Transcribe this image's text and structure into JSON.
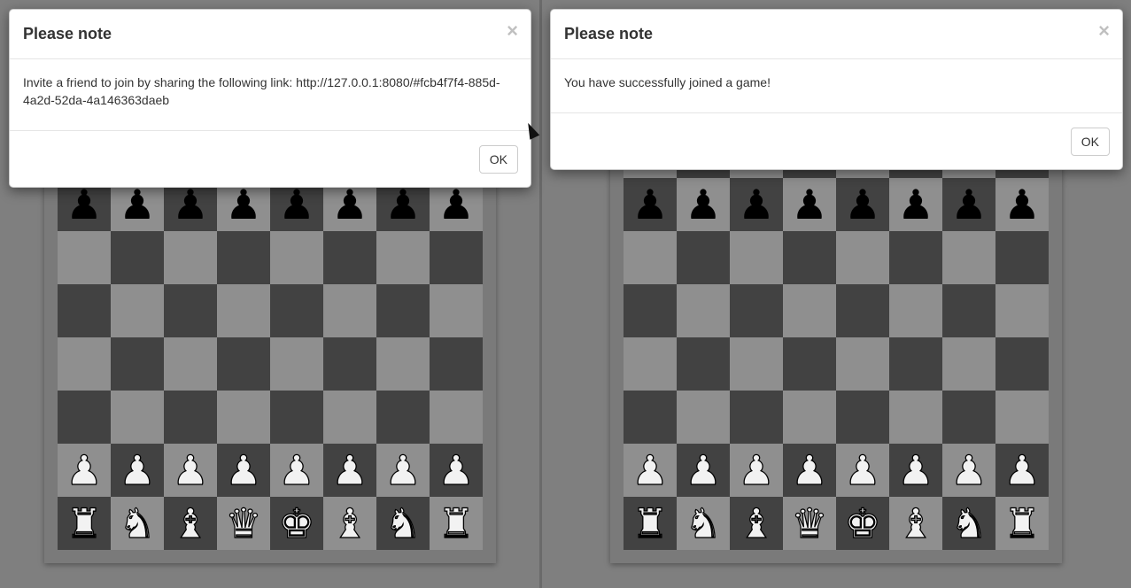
{
  "left_window": {
    "modal": {
      "title": "Please note",
      "close_glyph": "×",
      "body": "Invite a friend to join by sharing the following link: http://127.0.0.1:8080/#fcb4f7f4-885d-4a2d-52da-4a146363daeb",
      "ok_label": "OK"
    },
    "board": {
      "rows": [
        [
          "",
          "",
          "",
          "",
          "",
          "",
          "",
          ""
        ],
        [
          "♟",
          "♟",
          "♟",
          "♟",
          "♟",
          "♟",
          "♟",
          "♟"
        ],
        [
          "",
          "",
          "",
          "",
          "",
          "",
          "",
          ""
        ],
        [
          "",
          "",
          "",
          "",
          "",
          "",
          "",
          ""
        ],
        [
          "",
          "",
          "",
          "",
          "",
          "",
          "",
          ""
        ],
        [
          "",
          "",
          "",
          "",
          "",
          "",
          "",
          ""
        ],
        [
          "♟",
          "♟",
          "♟",
          "♟",
          "♟",
          "♟",
          "♟",
          "♟"
        ],
        [
          "♜",
          "♞",
          "♝",
          "♛",
          "♚",
          "♝",
          "♞",
          "♜"
        ]
      ],
      "colors": [
        [
          "",
          "",
          "",
          "",
          "",
          "",
          "",
          ""
        ],
        [
          "black",
          "black",
          "black",
          "black",
          "black",
          "black",
          "black",
          "black"
        ],
        [
          "",
          "",
          "",
          "",
          "",
          "",
          "",
          ""
        ],
        [
          "",
          "",
          "",
          "",
          "",
          "",
          "",
          ""
        ],
        [
          "",
          "",
          "",
          "",
          "",
          "",
          "",
          ""
        ],
        [
          "",
          "",
          "",
          "",
          "",
          "",
          "",
          ""
        ],
        [
          "white",
          "white",
          "white",
          "white",
          "white",
          "white",
          "white",
          "white"
        ],
        [
          "white",
          "white",
          "white",
          "white",
          "white",
          "white",
          "white",
          "white"
        ]
      ]
    }
  },
  "right_window": {
    "modal": {
      "title": "Please note",
      "close_glyph": "×",
      "body": "You have successfully joined a game!",
      "ok_label": "OK"
    },
    "board": {
      "rows": [
        [
          "",
          "",
          "",
          "",
          "",
          "",
          "",
          ""
        ],
        [
          "♟",
          "♟",
          "♟",
          "♟",
          "♟",
          "♟",
          "♟",
          "♟"
        ],
        [
          "",
          "",
          "",
          "",
          "",
          "",
          "",
          ""
        ],
        [
          "",
          "",
          "",
          "",
          "",
          "",
          "",
          ""
        ],
        [
          "",
          "",
          "",
          "",
          "",
          "",
          "",
          ""
        ],
        [
          "",
          "",
          "",
          "",
          "",
          "",
          "",
          ""
        ],
        [
          "♟",
          "♟",
          "♟",
          "♟",
          "♟",
          "♟",
          "♟",
          "♟"
        ],
        [
          "♜",
          "♞",
          "♝",
          "♛",
          "♚",
          "♝",
          "♞",
          "♜"
        ]
      ],
      "colors": [
        [
          "",
          "",
          "",
          "",
          "",
          "",
          "",
          ""
        ],
        [
          "black",
          "black",
          "black",
          "black",
          "black",
          "black",
          "black",
          "black"
        ],
        [
          "",
          "",
          "",
          "",
          "",
          "",
          "",
          ""
        ],
        [
          "",
          "",
          "",
          "",
          "",
          "",
          "",
          ""
        ],
        [
          "",
          "",
          "",
          "",
          "",
          "",
          "",
          ""
        ],
        [
          "",
          "",
          "",
          "",
          "",
          "",
          "",
          ""
        ],
        [
          "white",
          "white",
          "white",
          "white",
          "white",
          "white",
          "white",
          "white"
        ],
        [
          "white",
          "white",
          "white",
          "white",
          "white",
          "white",
          "white",
          "white"
        ]
      ]
    }
  },
  "colors": {
    "light_square": "#8f8f8f",
    "dark_square": "#424242",
    "backdrop": "#7f7f7f"
  }
}
